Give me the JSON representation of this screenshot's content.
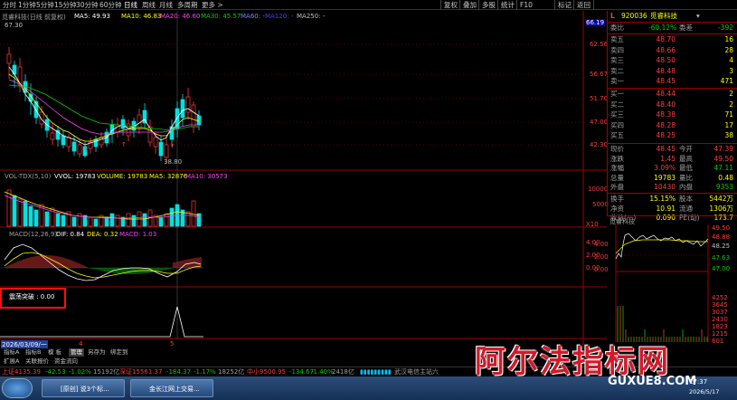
{
  "topbar": {
    "periods": [
      "分时",
      "1分钟",
      "5分钟",
      "15分钟",
      "30分钟",
      "60分钟",
      "日线",
      "周线",
      "月线",
      "多周期",
      "更多 >"
    ],
    "right": [
      "复权",
      "叠加",
      "多股",
      "统计",
      "F10",
      "标记",
      "返回"
    ]
  },
  "main": {
    "title_legend": "觅睿科技(日线 前复权)",
    "ma": [
      {
        "label": "MA5: 49.93",
        "color": "#ffffff"
      },
      {
        "label": "MA10: 46.83",
        "color": "#ffff00"
      },
      {
        "label": "MA20: 46.60",
        "color": "#ff40ff"
      },
      {
        "label": "MA30: 45.57",
        "color": "#00d000"
      },
      {
        "label": "MA60: -",
        "color": "#8080ff"
      },
      {
        "label": "MA120: -",
        "color": "#4040ff"
      },
      {
        "label": "MA250: -",
        "color": "#c0c0c0"
      }
    ],
    "high_label": "67.30",
    "low_label": "38.80",
    "price_ticks": [
      "66.19",
      "62.56",
      "56.67",
      "51.70",
      "47.00",
      "42.30"
    ],
    "vol_legend": {
      "name": "VOL-TDX(5,10)",
      "vvol": "VVOL: 19783",
      "volume": "VOLUME: 19783",
      "ma5": "MA5: 32876",
      "ma10": "MA10: 30573"
    },
    "vol_ticks": [
      "10000",
      "5000",
      "X10"
    ],
    "macd_legend": {
      "name": "MACD(12,26,9)",
      "dif": "DIF: 0.84",
      "dea": "DEA: 0.32",
      "macd": "MACD: 1.03"
    },
    "macd_ticks": [
      "4.00",
      "2.00",
      "0.00"
    ],
    "custom_legend": "震荡突破 : 0.00",
    "date_label": "2026/03/09/一",
    "tab_marks": [
      "4",
      "5"
    ]
  },
  "tabs": [
    "指标A",
    "指标B",
    "模 板",
    "管理",
    "另存为",
    "绑定到"
  ],
  "tabs2": [
    "扩展A",
    "关联报价",
    "资金流向"
  ],
  "quote": {
    "code": "920036",
    "name": "觅睿科技",
    "weibi_label": "委比",
    "weibi": "-60.12%",
    "weicha_label": "委差",
    "weicha": "-392",
    "asks": [
      {
        "label": "卖五",
        "price": "48.70",
        "vol": "16"
      },
      {
        "label": "卖四",
        "price": "48.66",
        "vol": "28"
      },
      {
        "label": "卖三",
        "price": "48.50",
        "vol": "4"
      },
      {
        "label": "卖二",
        "price": "48.48",
        "vol": "3"
      },
      {
        "label": "卖一",
        "price": "48.45",
        "vol": "471"
      }
    ],
    "bids": [
      {
        "label": "买一",
        "price": "48.44",
        "vol": "2"
      },
      {
        "label": "买二",
        "price": "48.40",
        "vol": "2"
      },
      {
        "label": "买三",
        "price": "48.38",
        "vol": "71"
      },
      {
        "label": "买四",
        "price": "48.28",
        "vol": "17"
      },
      {
        "label": "买五",
        "price": "48.25",
        "vol": "38"
      }
    ],
    "stats": [
      {
        "l": "现价",
        "v": "48.45",
        "l2": "今开",
        "v2": "47.39"
      },
      {
        "l": "涨跌",
        "v": "1.45",
        "l2": "最高",
        "v2": "49.50"
      },
      {
        "l": "涨幅",
        "v": "3.09%",
        "l2": "最低",
        "v2": "47.11"
      },
      {
        "l": "总量",
        "v": "19783",
        "l2": "量比",
        "v2": "0.48"
      },
      {
        "l": "外盘",
        "v": "10430",
        "l2": "内盘",
        "v2": "9353"
      }
    ],
    "stats2": [
      {
        "l": "换手",
        "v": "15.15%",
        "l2": "股本",
        "v2": "5442万"
      },
      {
        "l": "净资",
        "v": "10.91",
        "l2": "流通",
        "v2": "1306万"
      },
      {
        "l": "收益(一)",
        "v": "0.090",
        "l2": "PE(动)",
        "v2": "173.7"
      }
    ]
  },
  "mini": {
    "name": "觅睿科技",
    "left_ticks": [
      "4.00",
      "2.00",
      "0.00"
    ],
    "right_ticks": [
      "49.50",
      "48.88",
      "48.25",
      "47.63",
      "47.00",
      "4252",
      "3645",
      "3037",
      "2430",
      "1823",
      "1215",
      "601"
    ]
  },
  "status": {
    "sh": "上证4135.39",
    "sh_chg": "-42.53",
    "sh_pct": "-1.02%",
    "sh_amt": "15192亿",
    "sz": "深证15561.37",
    "sz_chg": "-184.37",
    "sz_pct": "-1.17%",
    "sz_amt": "18252亿",
    "zx": "中小9500.95",
    "zx_chg": "-134.67",
    "zx_pct": "-1.40%",
    "zx_amt": "2418亿",
    "server": "武汉电信主站六"
  },
  "taskbar": {
    "items": [
      "[原创] 说3个标...",
      "金长江网上交易..."
    ],
    "time": "17:37",
    "date": "2026/5/17"
  },
  "watermark": {
    "text": "阿尔法指标网",
    "url": "GUXUE8.COM"
  }
}
